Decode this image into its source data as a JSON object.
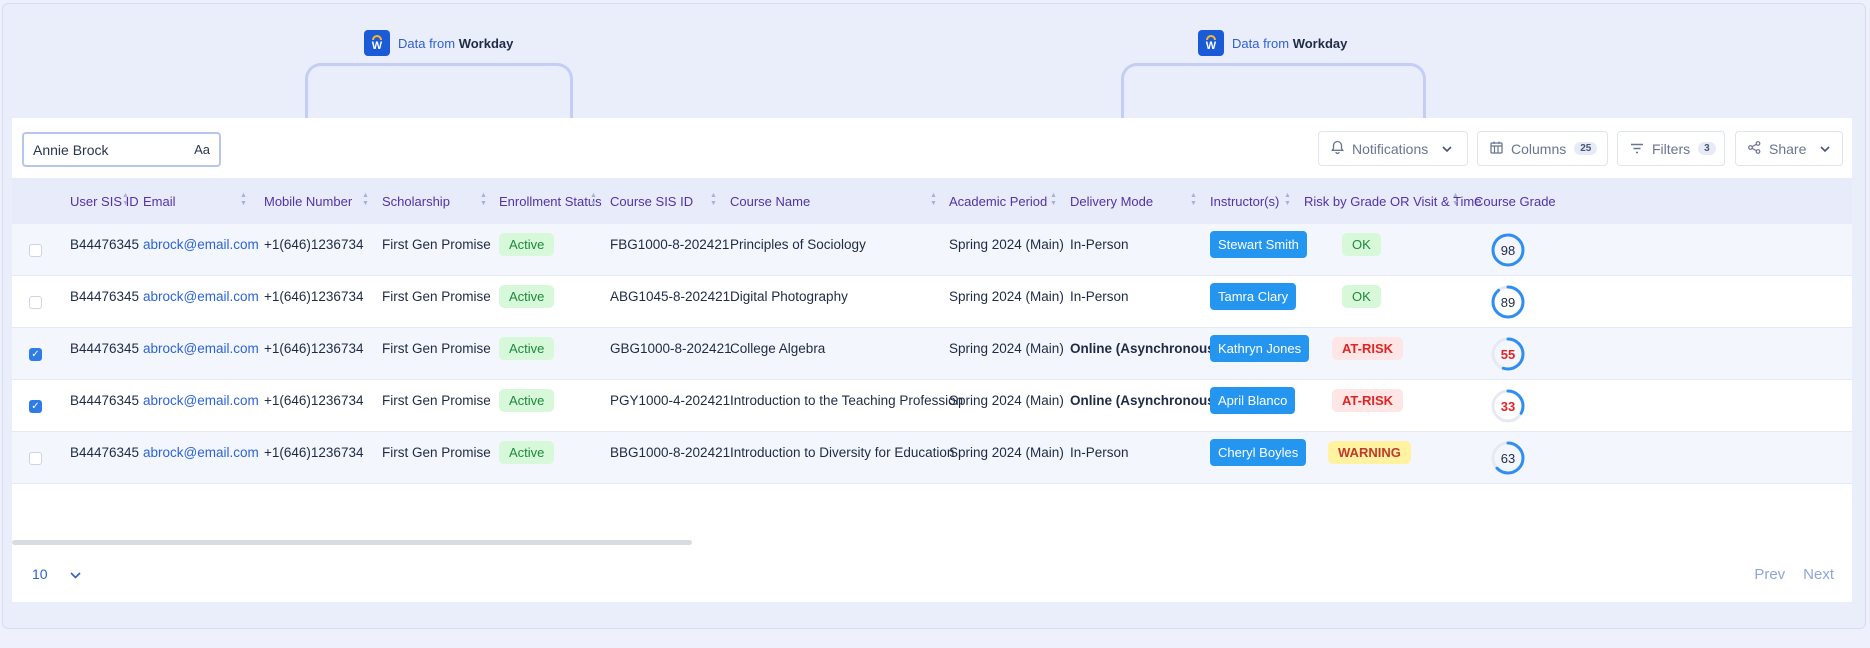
{
  "callouts": [
    {
      "prefix": "Data from",
      "brand": "Workday",
      "icon": "workday-icon"
    },
    {
      "prefix": "Data from",
      "brand": "Workday",
      "icon": "workday-icon"
    }
  ],
  "search": {
    "value": "Annie Brock",
    "match_case_label": "Aa"
  },
  "toolbar": {
    "notifications_label": "Notifications",
    "columns_label": "Columns",
    "columns_count": "25",
    "filters_label": "Filters",
    "filters_count": "3",
    "share_label": "Share"
  },
  "columns": [
    "User SIS ID",
    "Email",
    "Mobile Number",
    "Scholarship",
    "Enrollment Status",
    "Course SIS ID",
    "Course Name",
    "Academic Period",
    "Delivery Mode",
    "Instructor(s)",
    "Risk by Grade OR Visit & Time",
    "Course Grade"
  ],
  "rows": [
    {
      "checked": false,
      "sis_id": "B44476345",
      "email": "abrock@email.com",
      "mobile": "+1(646)1236734",
      "scholarship": "First Gen Promise",
      "status": "Active",
      "course_id": "FBG1000-8-202421",
      "course_name": "Principles of Sociology",
      "period": "Spring 2024 (Main)",
      "delivery": "In-Person",
      "delivery_bold": false,
      "instructor": "Stewart Smith",
      "risk": "OK",
      "risk_level": "ok",
      "grade": "98",
      "grade_fraction": 0.98,
      "grade_color": "#2f8ef0"
    },
    {
      "checked": false,
      "sis_id": "B44476345",
      "email": "abrock@email.com",
      "mobile": "+1(646)1236734",
      "scholarship": "First Gen Promise",
      "status": "Active",
      "course_id": "ABG1045-8-202421",
      "course_name": "Digital Photography",
      "period": "Spring 2024 (Main)",
      "delivery": "In-Person",
      "delivery_bold": false,
      "instructor": "Tamra Clary",
      "risk": "OK",
      "risk_level": "ok",
      "grade": "89",
      "grade_fraction": 0.89,
      "grade_color": "#2f8ef0"
    },
    {
      "checked": true,
      "sis_id": "B44476345",
      "email": "abrock@email.com",
      "mobile": "+1(646)1236734",
      "scholarship": "First Gen Promise",
      "status": "Active",
      "course_id": "GBG1000-8-202421",
      "course_name": "College Algebra",
      "period": "Spring 2024 (Main)",
      "delivery": "Online (Asynchronous)",
      "delivery_bold": true,
      "instructor": "Kathryn Jones",
      "risk": "AT-RISK",
      "risk_level": "at",
      "grade": "55",
      "grade_fraction": 0.55,
      "grade_color": "#2f8ef0"
    },
    {
      "checked": true,
      "sis_id": "B44476345",
      "email": "abrock@email.com",
      "mobile": "+1(646)1236734",
      "scholarship": "First Gen Promise",
      "status": "Active",
      "course_id": "PGY1000-4-202421",
      "course_name": "Introduction to the Teaching Profession",
      "period": "Spring 2024 (Main)",
      "delivery": "Online (Asynchronous)",
      "delivery_bold": true,
      "instructor": "April Blanco",
      "risk": "AT-RISK",
      "risk_level": "at",
      "grade": "33",
      "grade_fraction": 0.33,
      "grade_color": "#2f8ef0"
    },
    {
      "checked": false,
      "sis_id": "B44476345",
      "email": "abrock@email.com",
      "mobile": "+1(646)1236734",
      "scholarship": "First Gen Promise",
      "status": "Active",
      "course_id": "BBG1000-8-202421",
      "course_name": "Introduction to Diversity for Education",
      "period": "Spring 2024 (Main)",
      "delivery": "In-Person",
      "delivery_bold": false,
      "instructor": "Cheryl Boyles",
      "risk": "WARNING",
      "risk_level": "warn",
      "grade": "63",
      "grade_fraction": 0.63,
      "grade_color": "#2f8ef0"
    }
  ],
  "pagination": {
    "page_size": "10",
    "prev_label": "Prev",
    "next_label": "Next"
  },
  "colors": {
    "accent": "#2f5fd0",
    "header_text": "#5532a8",
    "active": "#1e8a3a",
    "at_risk": "#e02424",
    "warning_bg": "#fff3a1"
  }
}
